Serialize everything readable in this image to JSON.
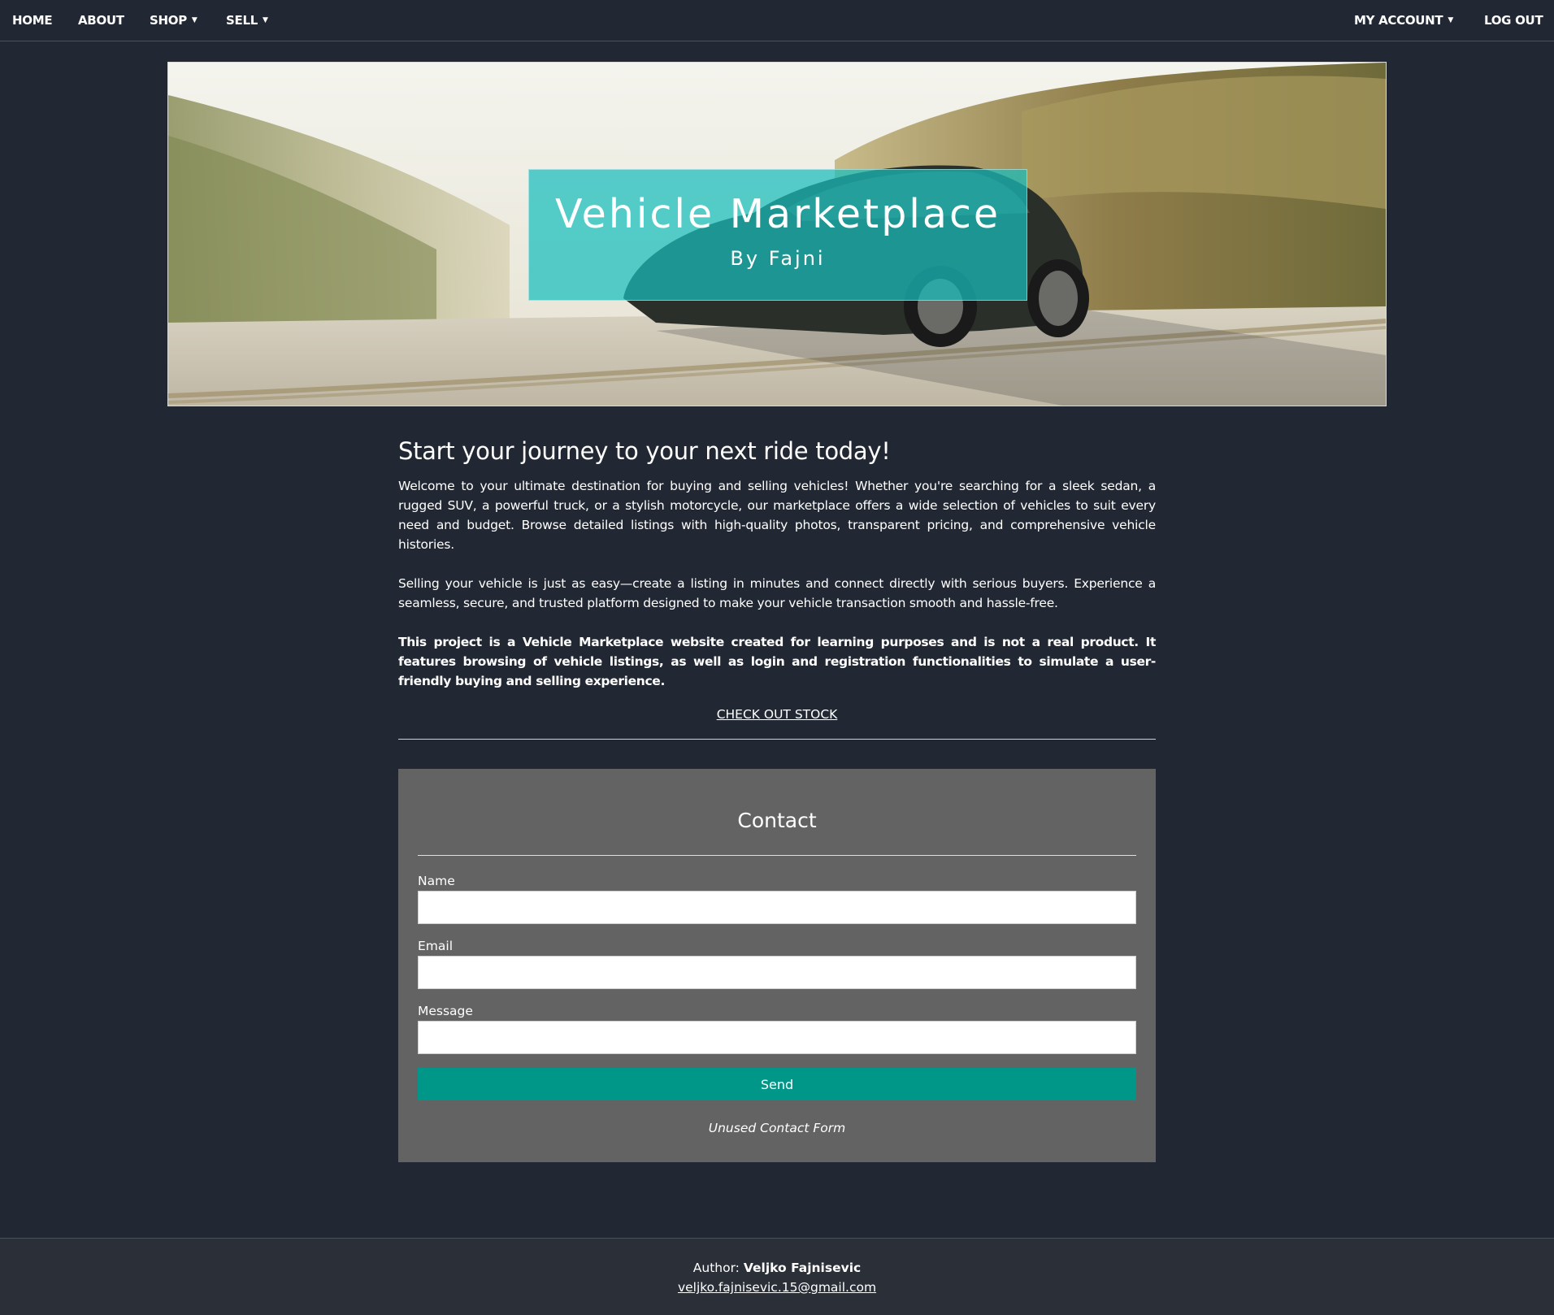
{
  "nav": {
    "home": "HOME",
    "about": "ABOUT",
    "shop": "SHOP",
    "sell": "SELL",
    "my_account": "MY ACCOUNT",
    "log_out": "LOG OUT",
    "caret_icon": "caret-down-icon"
  },
  "hero": {
    "title": "Vehicle Marketplace",
    "subtitle": "By Fajni",
    "image": "car-on-road-photo",
    "overlay_color": "#18bebc"
  },
  "main": {
    "heading": "Start your journey to your next ride today!",
    "paragraph_1": "Welcome to your ultimate destination for buying and selling vehicles! Whether you're searching for a sleek sedan, a rugged SUV, a powerful truck, or a stylish motorcycle, our marketplace offers a wide selection of vehicles to suit every need and budget. Browse detailed listings with high-quality photos, transparent pricing, and comprehensive vehicle histories.",
    "paragraph_2": "Selling your vehicle is just as easy—create a listing in minutes and connect directly with serious buyers. Experience a seamless, secure, and trusted platform designed to make your vehicle transaction smooth and hassle-free.",
    "paragraph_3": "This project is a Vehicle Marketplace website created for learning purposes and is not a real product. It features browsing of vehicle listings, as well as login and registration functionalities to simulate a user-friendly buying and selling experience.",
    "stock_link": "CHECK OUT STOCK"
  },
  "contact": {
    "title": "Contact",
    "name_label": "Name",
    "name_value": "",
    "email_label": "Email",
    "email_value": "",
    "message_label": "Message",
    "message_value": "",
    "send_label": "Send",
    "note": "Unused Contact Form",
    "button_color": "#009688"
  },
  "footer": {
    "author_label": "Author:",
    "author_name": "Veljko Fajnisevic",
    "email": "veljko.fajnisevic.15@gmail.com"
  },
  "colors": {
    "background": "#222833",
    "contact_panel": "#636363",
    "footer": "#2a2f38"
  }
}
